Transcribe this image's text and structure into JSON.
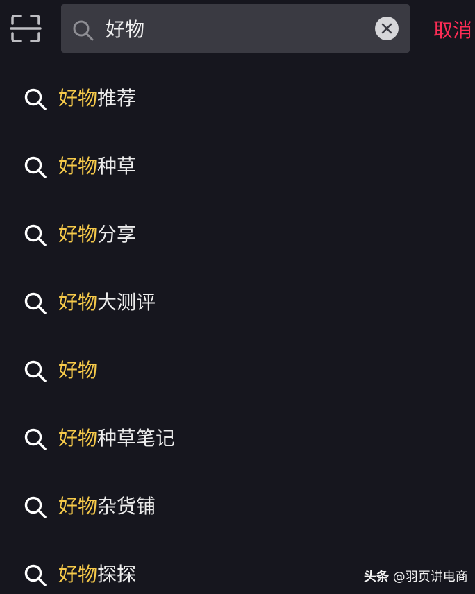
{
  "search": {
    "query": "好物",
    "cancel_label": "取消"
  },
  "suggestions": [
    {
      "highlight": "好物",
      "rest": "推荐"
    },
    {
      "highlight": "好物",
      "rest": "种草"
    },
    {
      "highlight": "好物",
      "rest": "分享"
    },
    {
      "highlight": "好物",
      "rest": "大测评"
    },
    {
      "highlight": "好物",
      "rest": ""
    },
    {
      "highlight": "好物",
      "rest": "种草笔记"
    },
    {
      "highlight": "好物",
      "rest": "杂货铺"
    },
    {
      "highlight": "好物",
      "rest": "探探"
    }
  ],
  "watermark": {
    "brand": "头条",
    "author": "@羽页讲电商"
  },
  "colors": {
    "background": "#16161e",
    "search_box": "#3a3a42",
    "highlight": "#f5c94a",
    "cancel": "#fe2c55",
    "text": "#ececec"
  },
  "icons": {
    "scan": "scan-icon",
    "search": "search-icon",
    "clear": "clear-icon",
    "suggestion": "search-icon"
  }
}
